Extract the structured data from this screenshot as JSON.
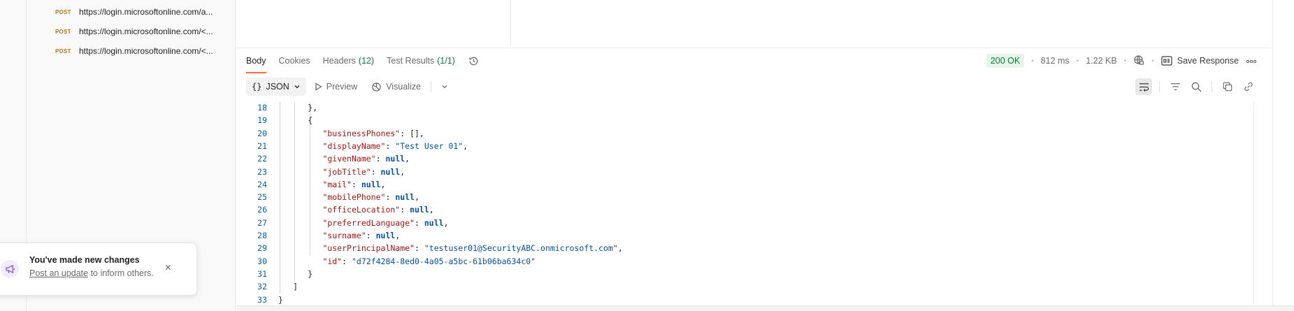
{
  "history": {
    "items": [
      {
        "method": "POST",
        "url": "https://login.microsoftonline.com/a..."
      },
      {
        "method": "POST",
        "url": "https://login.microsoftonline.com/<..."
      },
      {
        "method": "POST",
        "url": "https://login.microsoftonline.com/<..."
      }
    ]
  },
  "response": {
    "tabs": {
      "body": "Body",
      "cookies": "Cookies",
      "headers": "Headers",
      "headers_count": "(12)",
      "tests": "Test Results",
      "tests_count": "(1/1)"
    },
    "status": {
      "code": "200 OK",
      "time": "812 ms",
      "size": "1.22 KB",
      "save_label": "Save Response"
    },
    "toolbar": {
      "format_icon": "{}",
      "format": "JSON",
      "preview": "Preview",
      "visualize": "Visualize"
    },
    "code_lines": [
      {
        "n": "18",
        "indent": 6,
        "parts": [
          {
            "t": "},",
            "c": "p"
          }
        ]
      },
      {
        "n": "19",
        "indent": 6,
        "parts": [
          {
            "t": "{",
            "c": "p"
          }
        ]
      },
      {
        "n": "20",
        "indent": 9,
        "parts": [
          {
            "t": "\"businessPhones\"",
            "c": "k"
          },
          {
            "t": ": [],",
            "c": "p"
          }
        ]
      },
      {
        "n": "21",
        "indent": 9,
        "parts": [
          {
            "t": "\"displayName\"",
            "c": "k"
          },
          {
            "t": ": ",
            "c": "p"
          },
          {
            "t": "\"Test User 01\"",
            "c": "s"
          },
          {
            "t": ",",
            "c": "p"
          }
        ]
      },
      {
        "n": "22",
        "indent": 9,
        "parts": [
          {
            "t": "\"givenName\"",
            "c": "k"
          },
          {
            "t": ": ",
            "c": "p"
          },
          {
            "t": "null",
            "c": "n"
          },
          {
            "t": ",",
            "c": "p"
          }
        ]
      },
      {
        "n": "23",
        "indent": 9,
        "parts": [
          {
            "t": "\"jobTitle\"",
            "c": "k"
          },
          {
            "t": ": ",
            "c": "p"
          },
          {
            "t": "null",
            "c": "n"
          },
          {
            "t": ",",
            "c": "p"
          }
        ]
      },
      {
        "n": "24",
        "indent": 9,
        "parts": [
          {
            "t": "\"mail\"",
            "c": "k"
          },
          {
            "t": ": ",
            "c": "p"
          },
          {
            "t": "null",
            "c": "n"
          },
          {
            "t": ",",
            "c": "p"
          }
        ]
      },
      {
        "n": "25",
        "indent": 9,
        "parts": [
          {
            "t": "\"mobilePhone\"",
            "c": "k"
          },
          {
            "t": ": ",
            "c": "p"
          },
          {
            "t": "null",
            "c": "n"
          },
          {
            "t": ",",
            "c": "p"
          }
        ]
      },
      {
        "n": "26",
        "indent": 9,
        "parts": [
          {
            "t": "\"officeLocation\"",
            "c": "k"
          },
          {
            "t": ": ",
            "c": "p"
          },
          {
            "t": "null",
            "c": "n"
          },
          {
            "t": ",",
            "c": "p"
          }
        ]
      },
      {
        "n": "27",
        "indent": 9,
        "parts": [
          {
            "t": "\"preferredLanguage\"",
            "c": "k"
          },
          {
            "t": ": ",
            "c": "p"
          },
          {
            "t": "null",
            "c": "n"
          },
          {
            "t": ",",
            "c": "p"
          }
        ]
      },
      {
        "n": "28",
        "indent": 9,
        "parts": [
          {
            "t": "\"surname\"",
            "c": "k"
          },
          {
            "t": ": ",
            "c": "p"
          },
          {
            "t": "null",
            "c": "n"
          },
          {
            "t": ",",
            "c": "p"
          }
        ]
      },
      {
        "n": "29",
        "indent": 9,
        "parts": [
          {
            "t": "\"userPrincipalName\"",
            "c": "k"
          },
          {
            "t": ": ",
            "c": "p"
          },
          {
            "t": "\"testuser01@SecurityABC.onmicrosoft.com\"",
            "c": "s"
          },
          {
            "t": ",",
            "c": "p"
          }
        ]
      },
      {
        "n": "30",
        "indent": 9,
        "parts": [
          {
            "t": "\"id\"",
            "c": "k"
          },
          {
            "t": ": ",
            "c": "p"
          },
          {
            "t": "\"d72f4284-8ed0-4a05-a5bc-61b06ba634c0\"",
            "c": "s"
          }
        ]
      },
      {
        "n": "31",
        "indent": 6,
        "parts": [
          {
            "t": "}",
            "c": "p"
          }
        ]
      },
      {
        "n": "32",
        "indent": 3,
        "parts": [
          {
            "t": "]",
            "c": "p"
          }
        ]
      },
      {
        "n": "33",
        "indent": 0,
        "parts": [
          {
            "t": "}",
            "c": "p"
          }
        ]
      }
    ]
  },
  "toast": {
    "title": "You've made new changes",
    "link": "Post an update",
    "body_rest": " to inform others."
  },
  "colors": {
    "accent": "#ff6c37",
    "status_ok": "#0b7a3e",
    "method_post": "#b5770b"
  }
}
